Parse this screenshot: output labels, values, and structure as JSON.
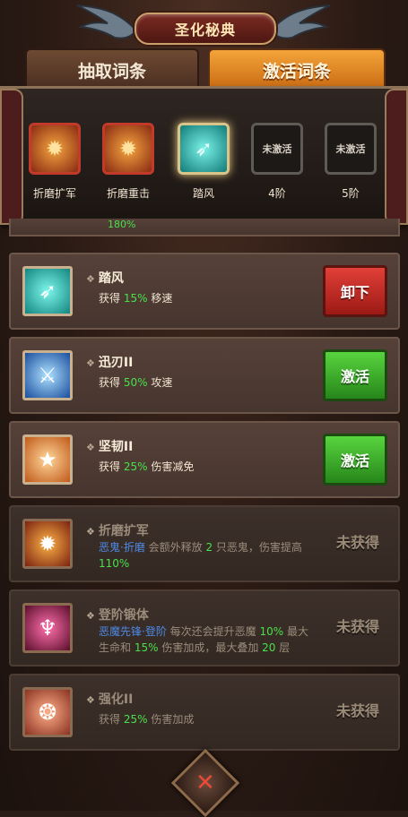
{
  "header": {
    "title": "圣化秘典"
  },
  "tabs": [
    {
      "label": "抽取词条"
    },
    {
      "label": "激活词条"
    }
  ],
  "slots": [
    {
      "label": "折磨扩军",
      "state": "fire-icon"
    },
    {
      "label": "折磨重击",
      "state": "fire-icon"
    },
    {
      "label": "踏风",
      "state": "wind-icon"
    },
    {
      "label": "4阶",
      "locked_text": "未激活"
    },
    {
      "label": "5阶",
      "locked_text": "未激活"
    }
  ],
  "partial": {
    "text": "180%"
  },
  "cards": [
    {
      "name": "踏风",
      "desc": {
        "prefix": "获得 ",
        "value": "15%",
        "suffix": " 移速"
      },
      "button": "卸下"
    },
    {
      "name": "迅刃II",
      "desc": {
        "prefix": "获得 ",
        "value": "50%",
        "suffix": " 攻速"
      },
      "button": "激活"
    },
    {
      "name": "坚韧II",
      "desc": {
        "prefix": "获得 ",
        "value": "25%",
        "suffix": " 伤害减免"
      },
      "button": "激活"
    },
    {
      "name": "折磨扩军",
      "desc": {
        "link": "恶鬼·折磨",
        "text1": " 会额外释放 ",
        "value1": "2",
        "text2": " 只恶鬼，伤害提高 ",
        "value2": "110%"
      },
      "button": "未获得"
    },
    {
      "name": "登阶锻体",
      "desc": {
        "link": "恶魔先锋·登阶",
        "text1": " 每次还会提升恶魔 ",
        "value1": "10%",
        "text2": " 最大生命和 ",
        "value2": "15%",
        "text3": " 伤害加成，最大叠加 ",
        "value3": "20",
        "text4": " 层"
      },
      "button": "未获得"
    },
    {
      "name": "强化II",
      "desc": {
        "prefix": "获得 ",
        "value": "25%",
        "suffix": " 伤害加成"
      },
      "button": "未获得"
    }
  ],
  "close": {
    "symbol": "✕"
  }
}
